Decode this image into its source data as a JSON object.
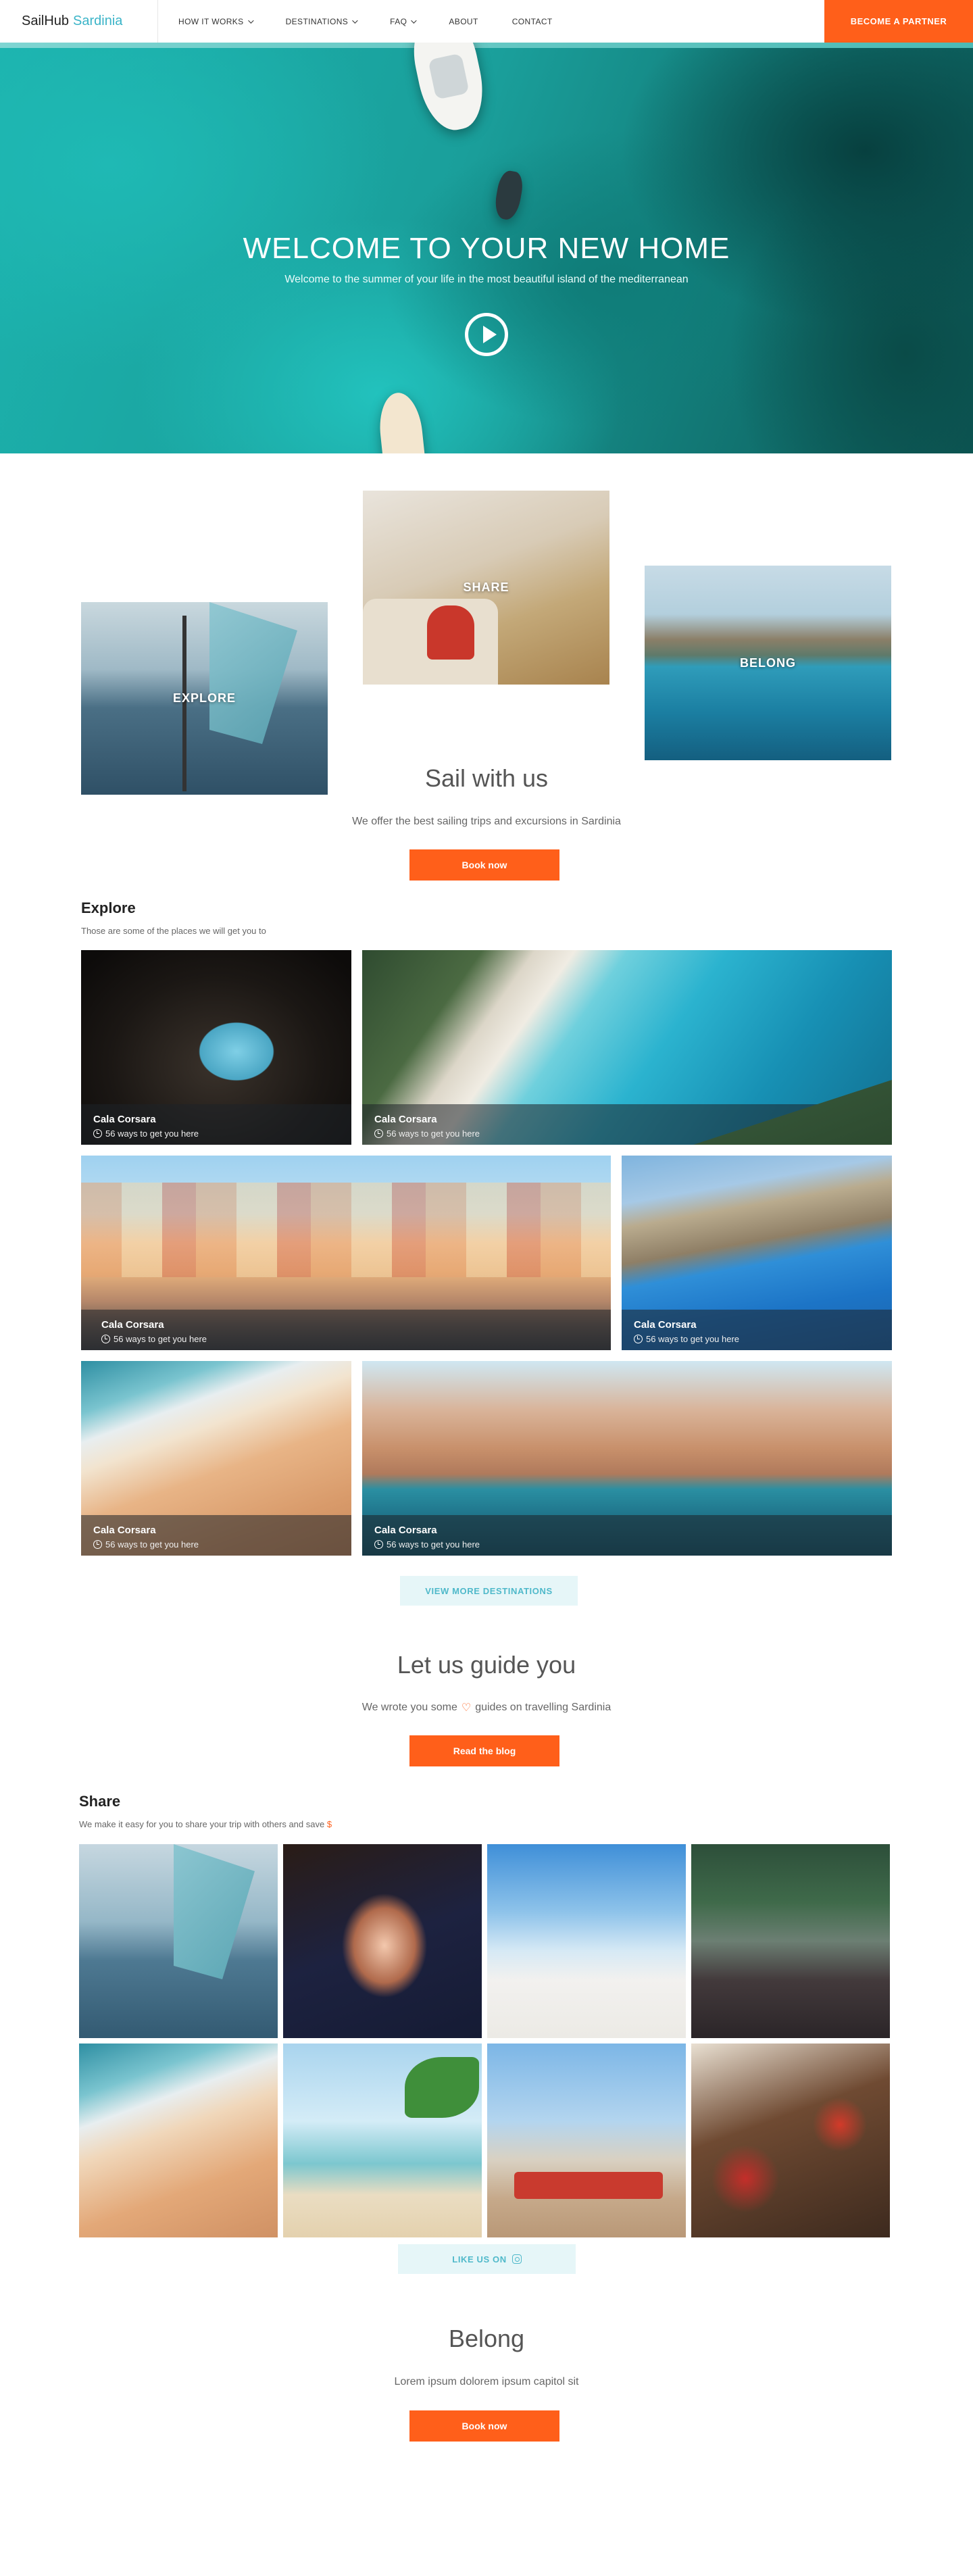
{
  "nav": {
    "brand_main": "SailHub",
    "brand_accent": "Sardinia",
    "items": [
      {
        "label": "HOW IT WORKS",
        "dropdown": true
      },
      {
        "label": "DESTINATIONS",
        "dropdown": true
      },
      {
        "label": "FAQ",
        "dropdown": true
      },
      {
        "label": "ABOUT",
        "dropdown": false
      },
      {
        "label": "CONTACT",
        "dropdown": false
      }
    ],
    "partner_button": "BECOME A PARTNER"
  },
  "hero": {
    "title": "WELCOME TO YOUR NEW HOME",
    "subtitle": "Welcome to the summer of your life in the most beautiful island of the mediterranean",
    "play_icon": "play-circle-icon"
  },
  "collage": {
    "explore": "EXPLORE",
    "share": "SHARE",
    "belong": "BELONG"
  },
  "sail": {
    "title": "Sail with us",
    "subtitle": "We offer the best sailing trips and excursions in Sardinia",
    "cta": "Book now"
  },
  "explore": {
    "title": "Explore",
    "subtitle": "Those are some of the places we will get you to",
    "tiles": [
      {
        "name": "Cala Corsara",
        "meta": "56 ways to get you here"
      },
      {
        "name": "Cala Corsara",
        "meta": "56 ways to get you here"
      },
      {
        "name": "Cala Corsara",
        "meta": "56 ways to get you here"
      },
      {
        "name": "Cala Corsara",
        "meta": "56 ways to get you here"
      },
      {
        "name": "Cala Corsara",
        "meta": "56 ways to get you here"
      },
      {
        "name": "Cala Corsara",
        "meta": "56 ways to get you here"
      }
    ],
    "more_button": "VIEW MORE DESTINATIONS"
  },
  "guide": {
    "title": "Let us guide you",
    "subtitle_before": "We wrote you some",
    "subtitle_after": "guides on travelling Sardinia",
    "cta": "Read the blog"
  },
  "share": {
    "title": "Share",
    "subtitle": "We make it easy for you to share your trip with others and save",
    "subtitle_symbol": "$",
    "like_button": "LIKE US ON"
  },
  "belong": {
    "title": "Belong",
    "subtitle": "Lorem ipsum dolorem ipsum capitol sit",
    "cta": "Book now"
  },
  "colors": {
    "accent_orange": "#ff5f1a",
    "accent_teal": "#3bb4c8"
  }
}
